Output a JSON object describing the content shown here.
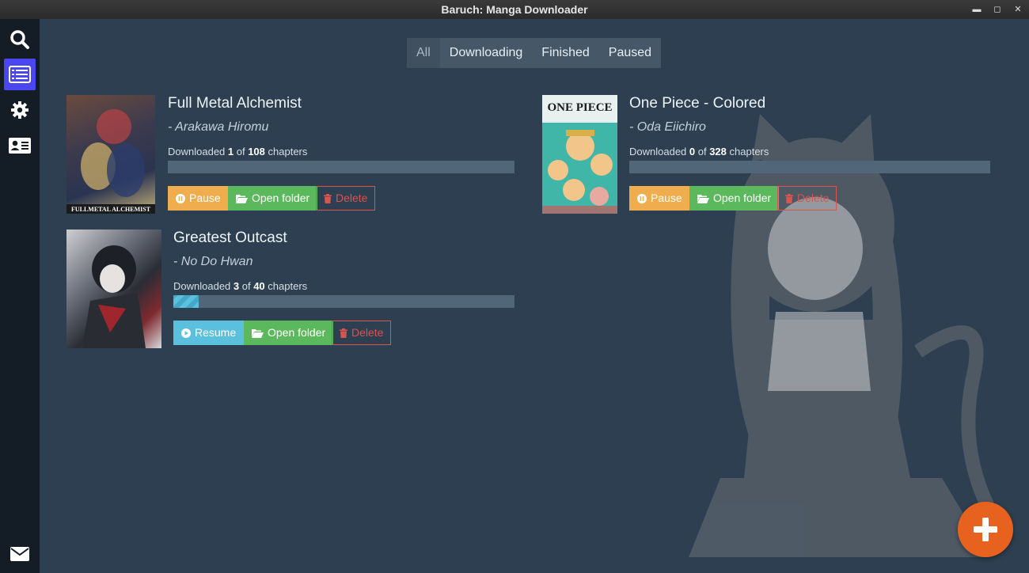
{
  "window": {
    "title": "Baruch: Manga Downloader"
  },
  "sidebar": {
    "items": [
      {
        "name": "search",
        "icon": "search-icon"
      },
      {
        "name": "list",
        "icon": "list-icon",
        "active": true
      },
      {
        "name": "settings",
        "icon": "gear-icon"
      },
      {
        "name": "about",
        "icon": "id-card-icon"
      },
      {
        "name": "contact",
        "icon": "envelope-icon"
      }
    ]
  },
  "tabs": [
    {
      "label": "All",
      "active": true
    },
    {
      "label": "Downloading"
    },
    {
      "label": "Finished"
    },
    {
      "label": "Paused"
    }
  ],
  "manga": [
    {
      "title": "Full Metal Alchemist",
      "author": "- Arakawa Hiromu",
      "progress_prefix": "Downloaded ",
      "downloaded": "1",
      "of_text": " of ",
      "total": "108",
      "suffix": " chapters",
      "progress_fraction": 0.0,
      "cover_text": "FULLMETAL ALCHEMIST",
      "actions": {
        "primary": "Pause",
        "folder": "Open folder",
        "delete": "Delete"
      }
    },
    {
      "title": "One Piece - Colored",
      "author": "- Oda Eiichiro",
      "progress_prefix": "Downloaded ",
      "downloaded": "0",
      "of_text": " of ",
      "total": "328",
      "suffix": " chapters",
      "progress_fraction": 0.0,
      "cover_text": "ONE PIECE",
      "actions": {
        "primary": "Pause",
        "folder": "Open folder",
        "delete": "Delete"
      }
    },
    {
      "title": "Greatest Outcast",
      "author": "- No Do Hwan",
      "progress_prefix": "Downloaded ",
      "downloaded": "3",
      "of_text": " of ",
      "total": "40",
      "suffix": " chapters",
      "progress_fraction": 0.075,
      "actions": {
        "primary": "Resume",
        "folder": "Open folder",
        "delete": "Delete"
      }
    }
  ],
  "fab": {
    "icon": "plus-icon"
  },
  "colors": {
    "accent": "#4a46f0",
    "warning": "#f0ad4e",
    "success": "#5cb85c",
    "info": "#5bc0de",
    "danger": "#d9534f",
    "fab": "#e8621f"
  }
}
